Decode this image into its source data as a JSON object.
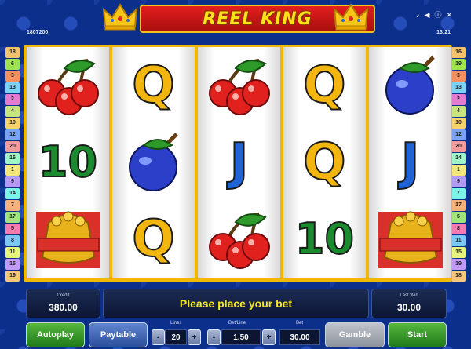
{
  "header": {
    "title": "REEL KING",
    "game_id": "1807200",
    "clock": "13:21",
    "sys_icons": [
      "music-note-icon",
      "speaker-icon",
      "info-icon",
      "close-icon"
    ]
  },
  "line_numbers_left": [
    "18",
    "6",
    "3",
    "13",
    "2",
    "4",
    "10",
    "12",
    "20",
    "16",
    "1",
    "9",
    "14",
    "7",
    "17",
    "5",
    "8",
    "11",
    "15",
    "19"
  ],
  "line_numbers_right": [
    "16",
    "19",
    "3",
    "13",
    "2",
    "4",
    "10",
    "12",
    "20",
    "14",
    "1",
    "9",
    "7",
    "17",
    "5",
    "8",
    "11",
    "15",
    "19",
    "18"
  ],
  "line_colors": [
    "#f2c36a",
    "#9ee34f",
    "#f58f5e",
    "#7bd3f5",
    "#e57bd0",
    "#c7e57b",
    "#f5d36a",
    "#7ba2f5",
    "#f59a9a",
    "#9ef5c5",
    "#f5e87b",
    "#b59af5",
    "#7bf5e8",
    "#f5b27b",
    "#a2e57b",
    "#f57bb0",
    "#7bc8f5",
    "#e8f57b",
    "#c09af5",
    "#f5c77b"
  ],
  "reels": [
    [
      "cherry",
      "10",
      "jackpot"
    ],
    [
      "Q",
      "plum",
      "Q"
    ],
    [
      "cherry",
      "J",
      "cherry"
    ],
    [
      "Q",
      "Q",
      "10"
    ],
    [
      "plum",
      "J",
      "jackpot"
    ]
  ],
  "info": {
    "credit_label": "Credit",
    "credit_value": "380.00",
    "message": "Please place your bet",
    "last_win_label": "Last Win",
    "last_win_value": "30.00"
  },
  "controls": {
    "autoplay": "Autoplay",
    "paytable": "Paytable",
    "lines_label": "Lines",
    "lines_value": "20",
    "bet_line_label": "Bet/Line",
    "bet_line_value": "1.50",
    "bet_label": "Bet",
    "bet_value": "30.00",
    "gamble": "Gamble",
    "start": "Start",
    "minus": "-",
    "plus": "+"
  }
}
